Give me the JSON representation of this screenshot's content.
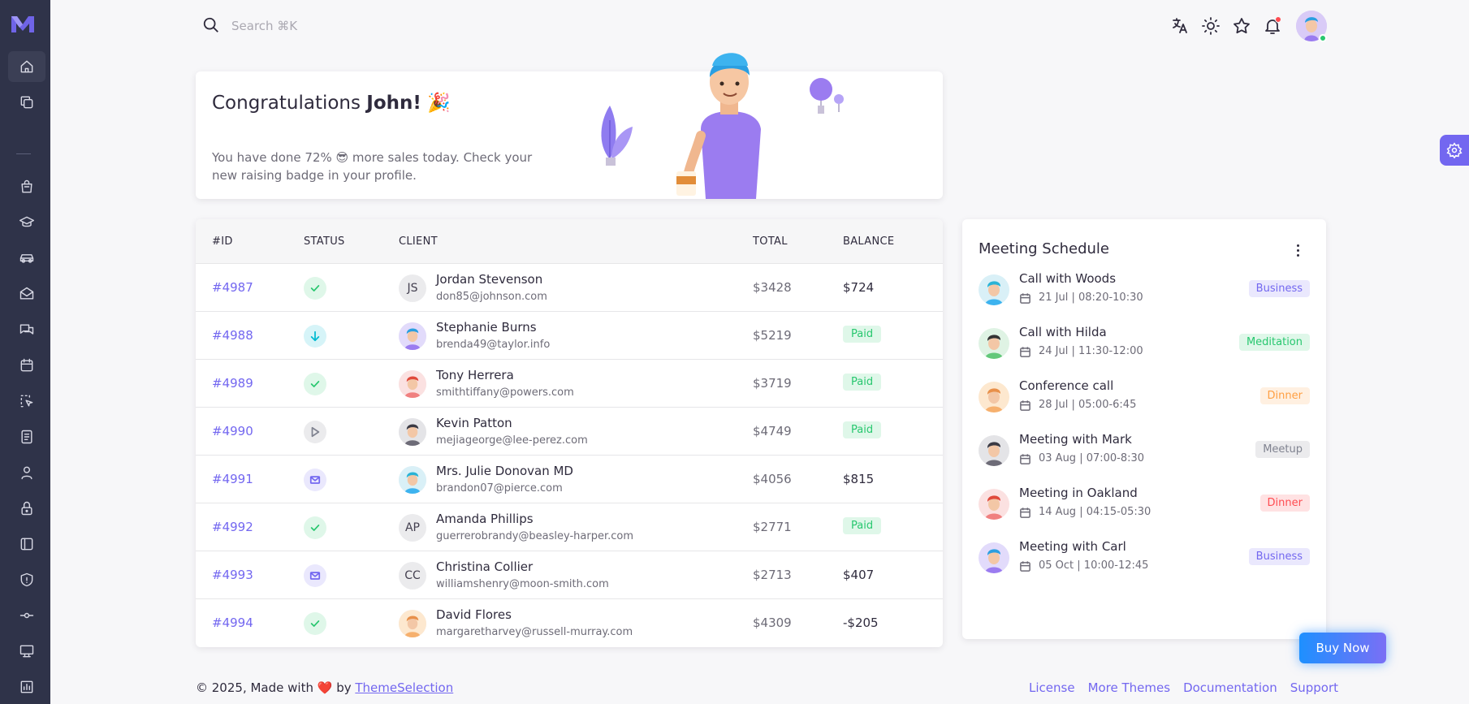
{
  "search": {
    "placeholder": "Search ⌘K"
  },
  "welcome": {
    "title_prefix": "Congratulations ",
    "title_name": "John!",
    "title_emoji": "🎉",
    "description": "You have done 72% 😎 more sales today. Check your new raising badge in your profile."
  },
  "table": {
    "headers": [
      "#ID",
      "STATUS",
      "CLIENT",
      "TOTAL",
      "BALANCE"
    ],
    "rows": [
      {
        "id": "#4987",
        "status": "check-icon",
        "initials": "JS",
        "name": "Jordan Stevenson",
        "email": "don85@johnson.com",
        "total": "$3428",
        "balance": "$724"
      },
      {
        "id": "#4988",
        "status": "arrow-down-icon",
        "initials": "",
        "name": "Stephanie Burns",
        "email": "brenda49@taylor.info",
        "total": "$5219",
        "balance": "Paid"
      },
      {
        "id": "#4989",
        "status": "check-icon",
        "initials": "",
        "name": "Tony Herrera",
        "email": "smithtiffany@powers.com",
        "total": "$3719",
        "balance": "Paid"
      },
      {
        "id": "#4990",
        "status": "play-icon",
        "initials": "",
        "name": "Kevin Patton",
        "email": "mejiageorge@lee-perez.com",
        "total": "$4749",
        "balance": "Paid"
      },
      {
        "id": "#4991",
        "status": "mail-icon",
        "initials": "",
        "name": "Mrs. Julie Donovan MD",
        "email": "brandon07@pierce.com",
        "total": "$4056",
        "balance": "$815"
      },
      {
        "id": "#4992",
        "status": "check-icon",
        "initials": "AP",
        "name": "Amanda Phillips",
        "email": "guerrerobrandy@beasley-harper.com",
        "total": "$2771",
        "balance": "Paid"
      },
      {
        "id": "#4993",
        "status": "mail-icon",
        "initials": "CC",
        "name": "Christina Collier",
        "email": "williamshenry@moon-smith.com",
        "total": "$2713",
        "balance": "$407"
      },
      {
        "id": "#4994",
        "status": "check-icon",
        "initials": "",
        "name": "David Flores",
        "email": "margaretharvey@russell-murray.com",
        "total": "$4309",
        "balance": "-$205"
      }
    ]
  },
  "meetings": {
    "title": "Meeting Schedule",
    "items": [
      {
        "title": "Call with Woods",
        "date": "21 Jul | 08:20-10:30",
        "badge": "Business",
        "badge_color": "#7367f0",
        "badge_bg": "#eae8fd"
      },
      {
        "title": "Call with Hilda",
        "date": "24 Jul | 11:30-12:00",
        "badge": "Meditation",
        "badge_color": "#28c76f",
        "badge_bg": "#dff7e9"
      },
      {
        "title": "Conference call",
        "date": "28 Jul | 05:00-6:45",
        "badge": "Dinner",
        "badge_color": "#ff9f43",
        "badge_bg": "#fff0e1"
      },
      {
        "title": "Meeting with Mark",
        "date": "03 Aug | 07:00-8:30",
        "badge": "Meetup",
        "badge_color": "#808390",
        "badge_bg": "#ebebed"
      },
      {
        "title": "Meeting in Oakland",
        "date": "14 Aug | 04:15-05:30",
        "badge": "Dinner",
        "badge_color": "#ff4c51",
        "badge_bg": "#ffe2e3"
      },
      {
        "title": "Meeting with Carl",
        "date": "05 Oct | 10:00-12:45",
        "badge": "Business",
        "badge_color": "#7367f0",
        "badge_bg": "#eae8fd"
      }
    ]
  },
  "buy_now": "Buy Now",
  "footer": {
    "copyright": "© 2025, Made with ",
    "heart": "❤️",
    "by": " by ",
    "brand": "ThemeSelection",
    "links": [
      "License",
      "More Themes",
      "Documentation",
      "Support"
    ]
  },
  "colors": {
    "primary": "#7367f0",
    "sidebar": "#2f3349",
    "success": "#28c76f",
    "info": "#00bad1",
    "secondary": "#808390"
  }
}
